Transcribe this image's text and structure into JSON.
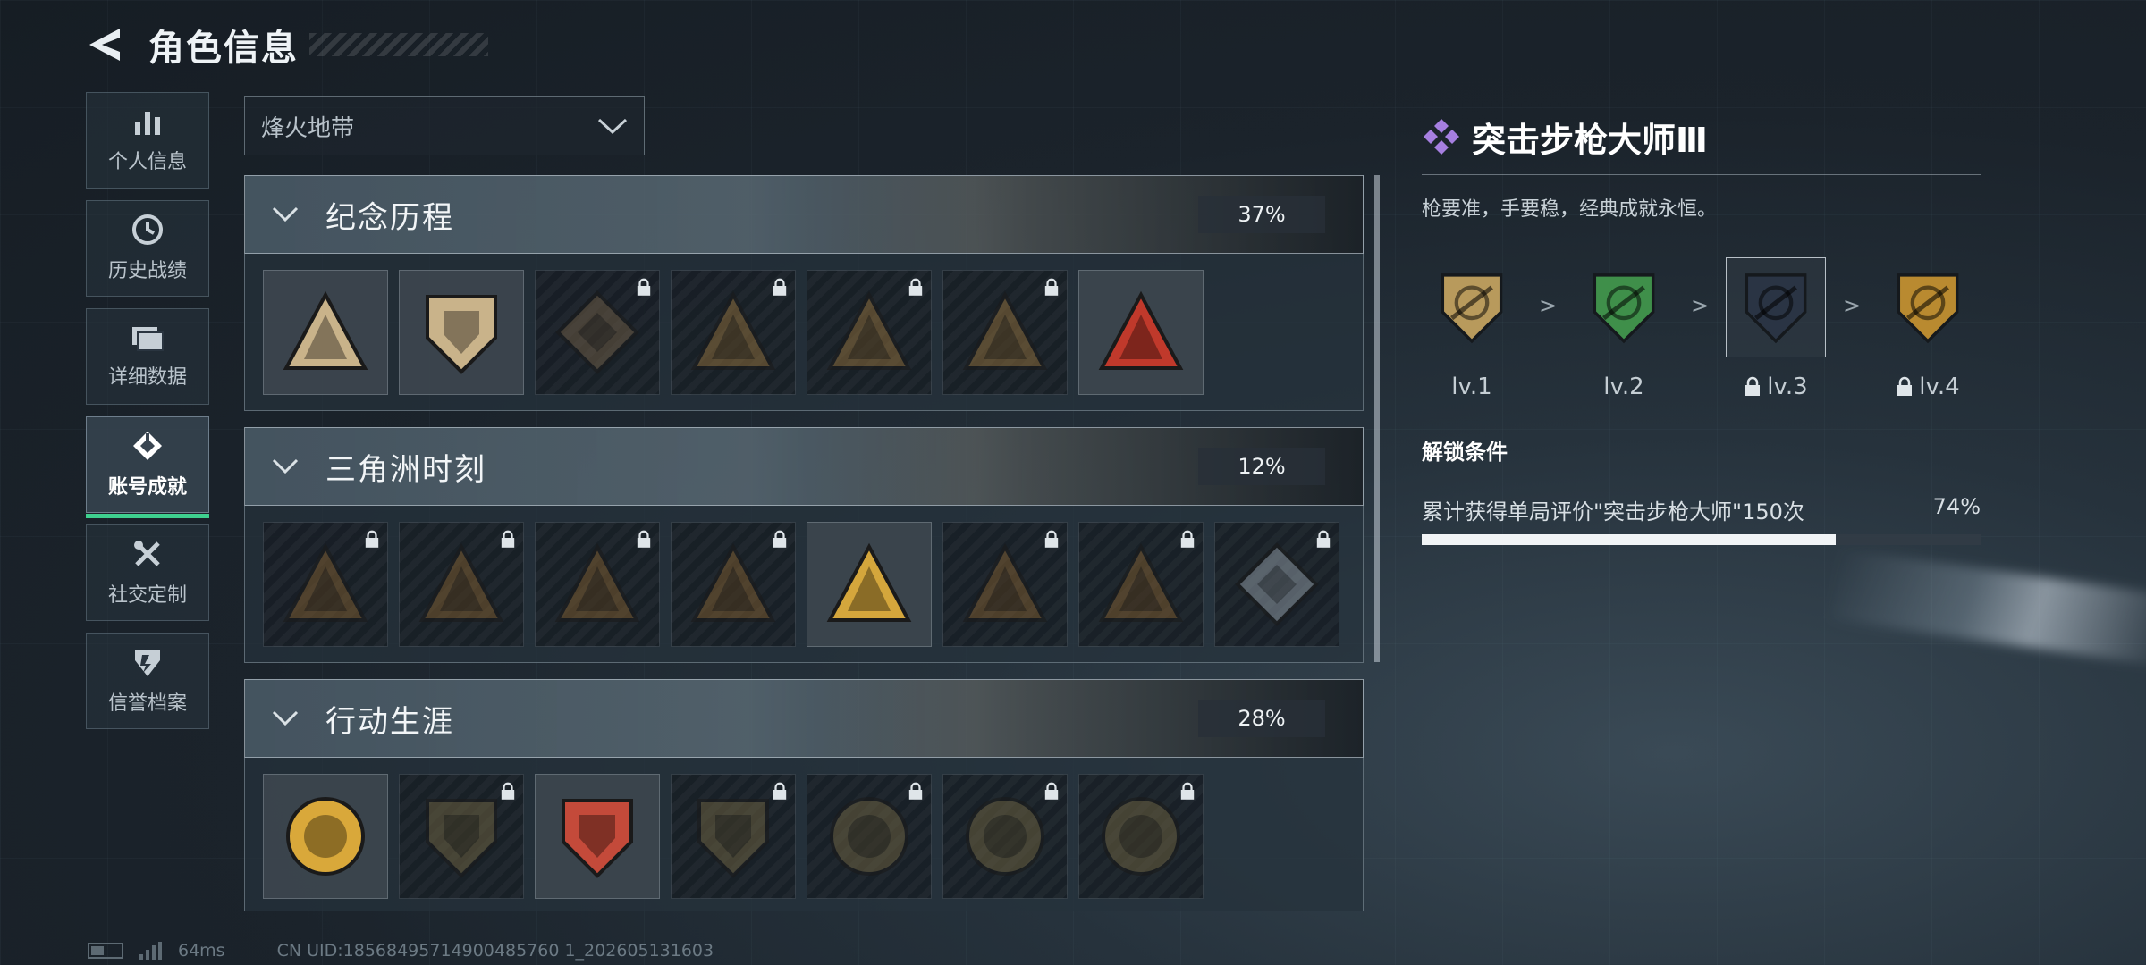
{
  "header": {
    "title": "角色信息"
  },
  "sidebar": {
    "items": [
      {
        "label": "个人信息",
        "icon": "bar-chart-icon"
      },
      {
        "label": "历史战绩",
        "icon": "clock-icon"
      },
      {
        "label": "详细数据",
        "icon": "folder-icon"
      },
      {
        "label": "账号成就",
        "icon": "trophy-icon",
        "active": true
      },
      {
        "label": "社交定制",
        "icon": "tools-icon"
      },
      {
        "label": "信誉档案",
        "icon": "shield-icon"
      }
    ]
  },
  "mode_select": {
    "value": "烽火地带"
  },
  "sections": [
    {
      "name": "纪念历程",
      "percent": "37%",
      "badges": [
        {
          "icon": "triangle-shield-icon",
          "locked": false,
          "color": "#c9b38a"
        },
        {
          "icon": "helicopter-shield-icon",
          "locked": false,
          "color": "#c9b38a"
        },
        {
          "icon": "diamond-shield-icon",
          "locked": true,
          "color": "#6b5a44"
        },
        {
          "icon": "tank-triangle-icon",
          "locked": true,
          "color": "#8a6b3a"
        },
        {
          "icon": "soldier-triangle-icon",
          "locked": true,
          "color": "#8a6b3a"
        },
        {
          "icon": "skull-triangle-icon",
          "locked": true,
          "color": "#8a6b3a"
        },
        {
          "icon": "number-one-triangle-icon",
          "locked": false,
          "color": "#c0392b"
        }
      ]
    },
    {
      "name": "三角洲时刻",
      "percent": "12%",
      "badges": [
        {
          "icon": "robot-triangle-icon",
          "locked": true,
          "color": "#7a5a30"
        },
        {
          "icon": "card-triangle-icon",
          "locked": true,
          "color": "#7a5a30"
        },
        {
          "icon": "runner-triangle-icon",
          "locked": true,
          "color": "#7a5a30"
        },
        {
          "icon": "hand-triangle-icon",
          "locked": true,
          "color": "#7a5a30"
        },
        {
          "icon": "squad-triangle-icon",
          "locked": false,
          "color": "#d4a63c"
        },
        {
          "icon": "team-triangle-icon",
          "locked": true,
          "color": "#7a5a30"
        },
        {
          "icon": "eagle-triangle-icon",
          "locked": true,
          "color": "#7a5a30"
        },
        {
          "icon": "rose-diamond-icon",
          "locked": true,
          "color": "#8a96a0"
        }
      ]
    },
    {
      "name": "行动生涯",
      "percent": "28%",
      "badges": [
        {
          "icon": "star-medal-icon",
          "locked": false,
          "color": "#d9a83a"
        },
        {
          "icon": "crest-shield-icon",
          "locked": true,
          "color": "#6a6040"
        },
        {
          "icon": "stars-shield-icon",
          "locked": false,
          "color": "#c44a3a"
        },
        {
          "icon": "dice-shield-icon",
          "locked": true,
          "color": "#6a6040"
        },
        {
          "icon": "oyster-circle-icon",
          "locked": true,
          "color": "#6a6040"
        },
        {
          "icon": "skull-circle-icon",
          "locked": true,
          "color": "#6a6040"
        },
        {
          "icon": "eye-circle-icon",
          "locked": true,
          "color": "#6a6040"
        }
      ]
    }
  ],
  "detail": {
    "title": "突击步枪大师Ⅲ",
    "description": "枪要准，手要稳，经典成就永恒。",
    "levels": [
      {
        "label": "lv.1",
        "locked": false,
        "color": "#b89a5c",
        "selected": false
      },
      {
        "label": "lv.2",
        "locked": false,
        "color": "#3f8f4a",
        "selected": false
      },
      {
        "label": "lv.3",
        "locked": true,
        "color": "#2a3444",
        "selected": true
      },
      {
        "label": "lv.4",
        "locked": true,
        "color": "#b98a30",
        "selected": false
      }
    ],
    "condition_title": "解锁条件",
    "condition_text": "累计获得单局评价\"突击步枪大师\"150次",
    "progress_label": "74%",
    "progress": 0.74,
    "accent_color": "#a67fe0"
  },
  "footer": {
    "ping": "64ms",
    "uid": "CN UID:18568495714900485760 1_202605131603"
  }
}
